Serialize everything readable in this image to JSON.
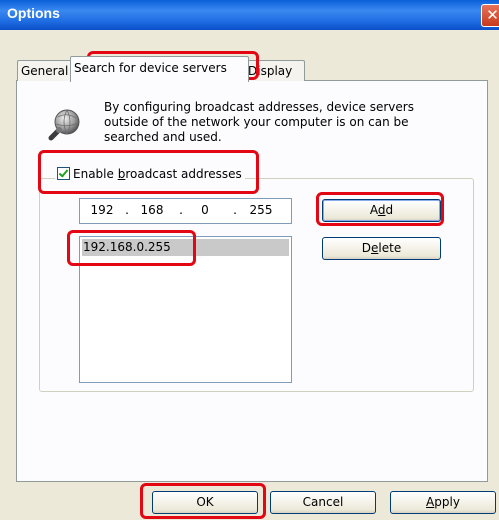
{
  "window": {
    "title": "Options",
    "close_glyph": "✕"
  },
  "tabs": [
    {
      "label": "General"
    },
    {
      "label": "Search for device servers"
    },
    {
      "label": "Display"
    }
  ],
  "info": {
    "icon": "search-globe-icon",
    "text": "By configuring broadcast addresses, device servers outside of the network your computer is on can be searched and used."
  },
  "broadcast": {
    "checkbox_prefix": "Enable ",
    "checkbox_accel": "b",
    "checkbox_suffix": "roadcast addresses",
    "checked": true,
    "ip_octets": [
      "192",
      "168",
      "0",
      "255"
    ],
    "ip_separator": ".",
    "add_prefix": "A",
    "add_accel": "d",
    "add_suffix": "d",
    "delete_prefix": "D",
    "delete_accel": "e",
    "delete_suffix": "lete",
    "addresses": [
      "192.168.0.255"
    ]
  },
  "footer": {
    "ok_label": "OK",
    "cancel_label": "Cancel",
    "apply_accel": "A",
    "apply_suffix": "pply"
  },
  "colors": {
    "highlight": "#e30613",
    "titlebar": "#0a5fd8",
    "dialog_bg": "#ece9d8"
  }
}
